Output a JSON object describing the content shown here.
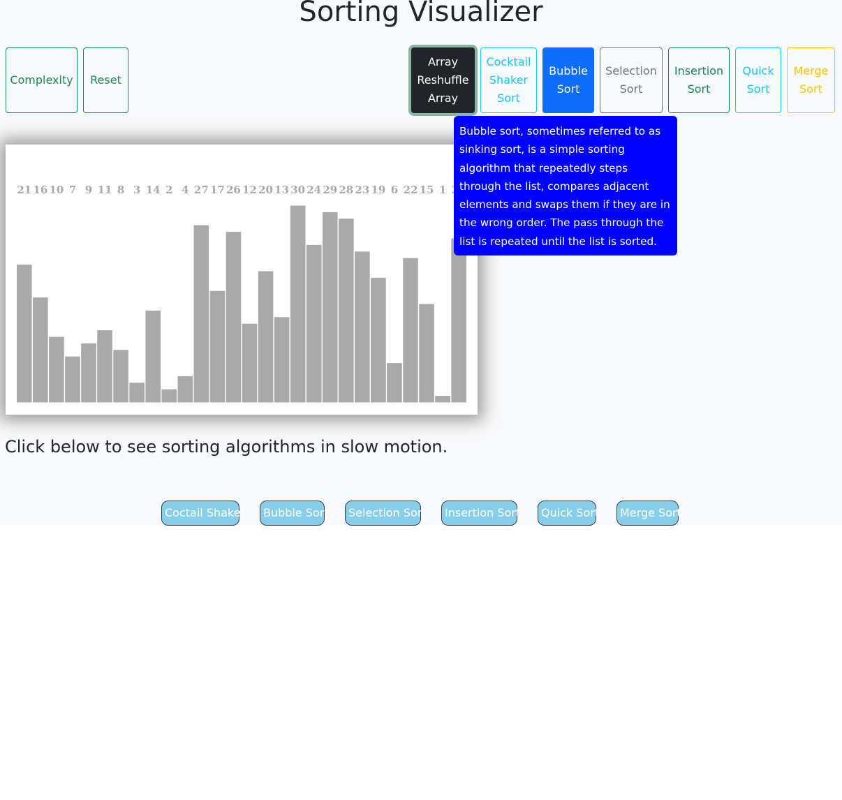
{
  "header": {
    "title": "Sorting Visualizer"
  },
  "left_buttons": [
    {
      "label": "Complexity",
      "style": "success"
    },
    {
      "label": "Reset",
      "style": "success"
    }
  ],
  "algorithm_buttons": [
    {
      "label": "Array Reshuffle Array",
      "style": "dark"
    },
    {
      "label": "Cocktail Shaker Sort",
      "style": "info"
    },
    {
      "label": "Bubble Sort",
      "style": "primary"
    },
    {
      "label": "Selection Sort",
      "style": "secondary"
    },
    {
      "label": "Insertion Sort",
      "style": "success"
    },
    {
      "label": "Quick Sort",
      "style": "info"
    },
    {
      "label": "Merge Sort",
      "style": "warning"
    }
  ],
  "tooltip": {
    "text": "Bubble sort, sometimes referred to as sinking sort, is a simple sorting algorithm that repeatedly steps through the list, compares adjacent elements and swaps them if they are in the wrong order. The pass through the list is repeated until the list is sorted.",
    "background": "#0000ff"
  },
  "chart_data": {
    "type": "bar",
    "values": [
      21,
      16,
      10,
      7,
      9,
      11,
      8,
      3,
      14,
      2,
      4,
      27,
      17,
      26,
      12,
      20,
      13,
      30,
      24,
      29,
      28,
      23,
      19,
      6,
      22,
      15,
      1,
      25
    ],
    "ylim": [
      0,
      30
    ],
    "bar_color": "#a9a9a9",
    "label_color": "#a9a9a9"
  },
  "caption": "Click below to see sorting algorithms in slow motion.",
  "animation_buttons": [
    {
      "label": "Coctail Shaker"
    },
    {
      "label": "Bubble Sort"
    },
    {
      "label": "Selection Sort"
    },
    {
      "label": "Insertion Sort"
    },
    {
      "label": "Quick Sort"
    },
    {
      "label": "Merge Sort"
    }
  ],
  "colors": {
    "page_background": "#f8f9fa",
    "success": "#198754",
    "info": "#0dcaf0",
    "primary": "#0d6efd",
    "secondary": "#6c757d",
    "warning": "#ffc107",
    "dark": "#212529",
    "animation_button": "#87ceeb"
  }
}
